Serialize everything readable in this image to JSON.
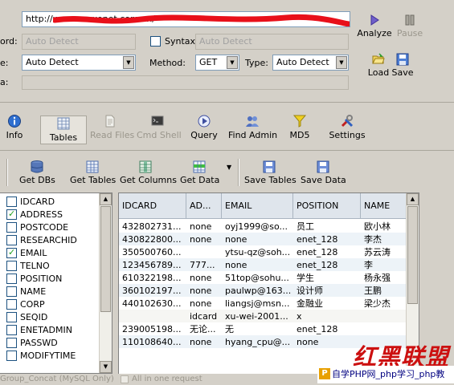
{
  "request": {
    "url": "http://www.xxxxenet.com.cn/",
    "keyword_label": "ord:",
    "keyword_value": "Auto Detect",
    "syntax_label": "Syntax:",
    "syntax_value": "Auto Detect",
    "type_row_label": "e:",
    "db_type_value": "Auto Detect",
    "method_label": "Method:",
    "method_value": "GET",
    "type_label": "Type:",
    "type_value": "Auto Detect",
    "third_label": "a:",
    "analyze_label": "Analyze",
    "pause_label": "Pause",
    "load_label": "Load",
    "save_label": "Save"
  },
  "tabs": [
    {
      "label": "Info",
      "icon": "info-icon",
      "active": false,
      "enabled": true
    },
    {
      "label": "Tables",
      "icon": "tables-icon",
      "active": true,
      "enabled": true
    },
    {
      "label": "Read Files",
      "icon": "read-files-icon",
      "active": false,
      "enabled": false
    },
    {
      "label": "Cmd Shell",
      "icon": "cmd-shell-icon",
      "active": false,
      "enabled": false
    },
    {
      "label": "Query",
      "icon": "query-icon",
      "active": false,
      "enabled": true
    },
    {
      "label": "Find Admin",
      "icon": "find-admin-icon",
      "active": false,
      "enabled": true
    },
    {
      "label": "MD5",
      "icon": "md5-icon",
      "active": false,
      "enabled": true
    },
    {
      "label": "Settings",
      "icon": "settings-icon",
      "active": false,
      "enabled": true
    }
  ],
  "actions": [
    {
      "label": "Get DBs",
      "icon": "database-icon"
    },
    {
      "label": "Get Tables",
      "icon": "table-icon"
    },
    {
      "label": "Get Columns",
      "icon": "columns-icon"
    },
    {
      "label": "Get Data",
      "icon": "data-icon"
    },
    {
      "label": "Save Tables",
      "icon": "floppy-icon"
    },
    {
      "label": "Save Data",
      "icon": "floppy-icon"
    }
  ],
  "columns": [
    {
      "name": "IDCARD",
      "checked": false
    },
    {
      "name": "ADDRESS",
      "checked": true
    },
    {
      "name": "POSTCODE",
      "checked": false
    },
    {
      "name": "RESEARCHID",
      "checked": false
    },
    {
      "name": "EMAIL",
      "checked": true
    },
    {
      "name": "TELNO",
      "checked": false
    },
    {
      "name": "POSITION",
      "checked": false
    },
    {
      "name": "NAME",
      "checked": false
    },
    {
      "name": "CORP",
      "checked": false
    },
    {
      "name": "SEQID",
      "checked": false
    },
    {
      "name": "ENETADMIN",
      "checked": false
    },
    {
      "name": "PASSWD",
      "checked": false
    },
    {
      "name": "MODIFYTIME",
      "checked": false
    }
  ],
  "grid": {
    "headers": [
      "IDCARD",
      "AD...",
      "EMAIL",
      "POSITION",
      "NAME"
    ],
    "rows": [
      [
        "432802731...",
        "none",
        "oyj1999@so...",
        "员工",
        "欧小林"
      ],
      [
        "430822800...",
        "none",
        "none",
        "enet_128",
        "李杰"
      ],
      [
        "350500760...",
        "",
        "ytsu-qz@soh...",
        "enet_128",
        "苏云涛"
      ],
      [
        "123456789...",
        "777...",
        "none",
        "enet_128",
        "李"
      ],
      [
        "610322198...",
        "none",
        "51top@sohu...",
        "学生",
        "杨永强"
      ],
      [
        "360102197...",
        "none",
        "paulwp@163...",
        "设计师",
        "王鹏"
      ],
      [
        "440102630...",
        "none",
        "liangsj@msn...",
        "金融业",
        "梁少杰"
      ],
      [
        "",
        "idcard",
        "xu-wei-2001...",
        "x",
        ""
      ],
      [
        "239005198...",
        "无论...",
        "无",
        "enet_128",
        ""
      ],
      [
        "110108640...",
        "none",
        "hyang_cpu@...",
        "none",
        ""
      ]
    ]
  },
  "status": {
    "left_text": "Group_Concat (MySQL Only)",
    "right_text": "All in one request"
  },
  "watermark": {
    "logo": "红黑联盟",
    "text": "自学PHP网_php学习_php教"
  }
}
